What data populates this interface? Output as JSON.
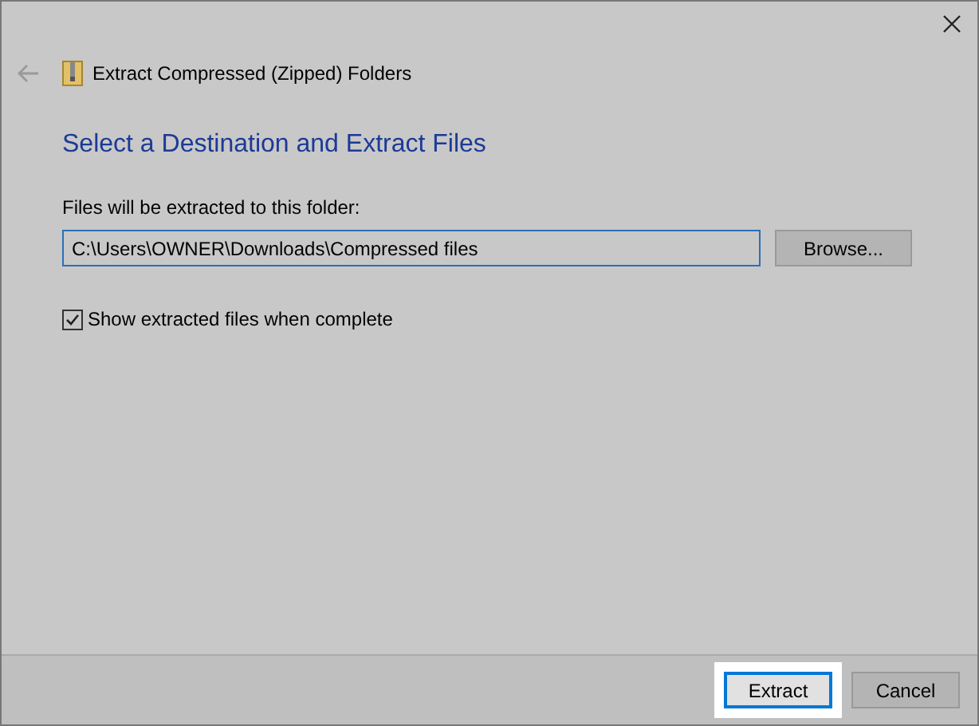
{
  "window": {
    "title": "Extract Compressed (Zipped) Folders"
  },
  "heading": "Select a Destination and Extract Files",
  "destination": {
    "label": "Files will be extracted to this folder:",
    "value": "C:\\Users\\OWNER\\Downloads\\Compressed files",
    "browse": "Browse..."
  },
  "show_files": {
    "label": "Show extracted files when complete",
    "checked": true
  },
  "buttons": [
    {
      "label": "Extract",
      "default": true,
      "highlighted": true
    },
    {
      "label": "Cancel",
      "default": false,
      "highlighted": false
    }
  ]
}
